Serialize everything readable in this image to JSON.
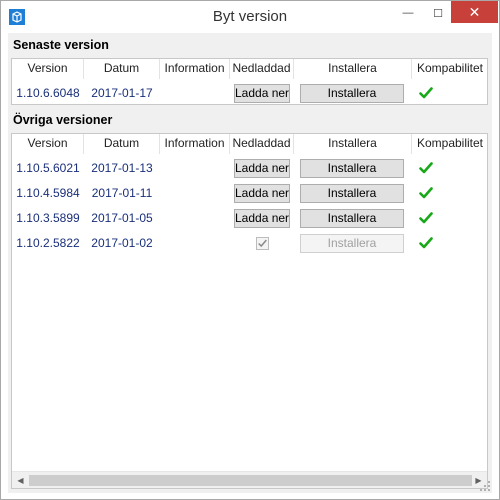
{
  "window": {
    "title": "Byt version",
    "min_glyph": "—",
    "max_glyph": "☐",
    "close_glyph": "✕"
  },
  "latest": {
    "title": "Senaste version",
    "columns": [
      "Version",
      "Datum",
      "Information",
      "Nedladdad",
      "Installera",
      "Kompabilitet"
    ],
    "rows": [
      {
        "version": "1.10.6.6048",
        "date": "2017-01-17",
        "information": "",
        "download_label": "Ladda ner",
        "install_label": "Installera",
        "downloaded": false,
        "install_enabled": true,
        "compatible": true
      }
    ]
  },
  "other": {
    "title": "Övriga versioner",
    "columns": [
      "Version",
      "Datum",
      "Information",
      "Nedladdad",
      "Installera",
      "Kompabilitet"
    ],
    "rows": [
      {
        "version": "1.10.5.6021",
        "date": "2017-01-13",
        "information": "",
        "download_label": "Ladda ner",
        "install_label": "Installera",
        "downloaded": false,
        "install_enabled": true,
        "compatible": true
      },
      {
        "version": "1.10.4.5984",
        "date": "2017-01-11",
        "information": "",
        "download_label": "Ladda ner",
        "install_label": "Installera",
        "downloaded": false,
        "install_enabled": true,
        "compatible": true
      },
      {
        "version": "1.10.3.5899",
        "date": "2017-01-05",
        "information": "",
        "download_label": "Ladda ner",
        "install_label": "Installera",
        "downloaded": false,
        "install_enabled": true,
        "compatible": true
      },
      {
        "version": "1.10.2.5822",
        "date": "2017-01-02",
        "information": "",
        "download_label": "",
        "install_label": "Installera",
        "downloaded": true,
        "install_enabled": false,
        "compatible": true
      }
    ]
  },
  "colors": {
    "close_button": "#c7413a",
    "check_green": "#19a819",
    "value_text": "#1a2f7a"
  },
  "icons": {
    "app": "app-cube-icon",
    "compatible": "green-checkmark-icon",
    "scroll_left": "scroll-left-arrow-icon",
    "scroll_right": "scroll-right-arrow-icon"
  },
  "scrollbar": {
    "left_glyph": "◀",
    "right_glyph": "▶"
  }
}
